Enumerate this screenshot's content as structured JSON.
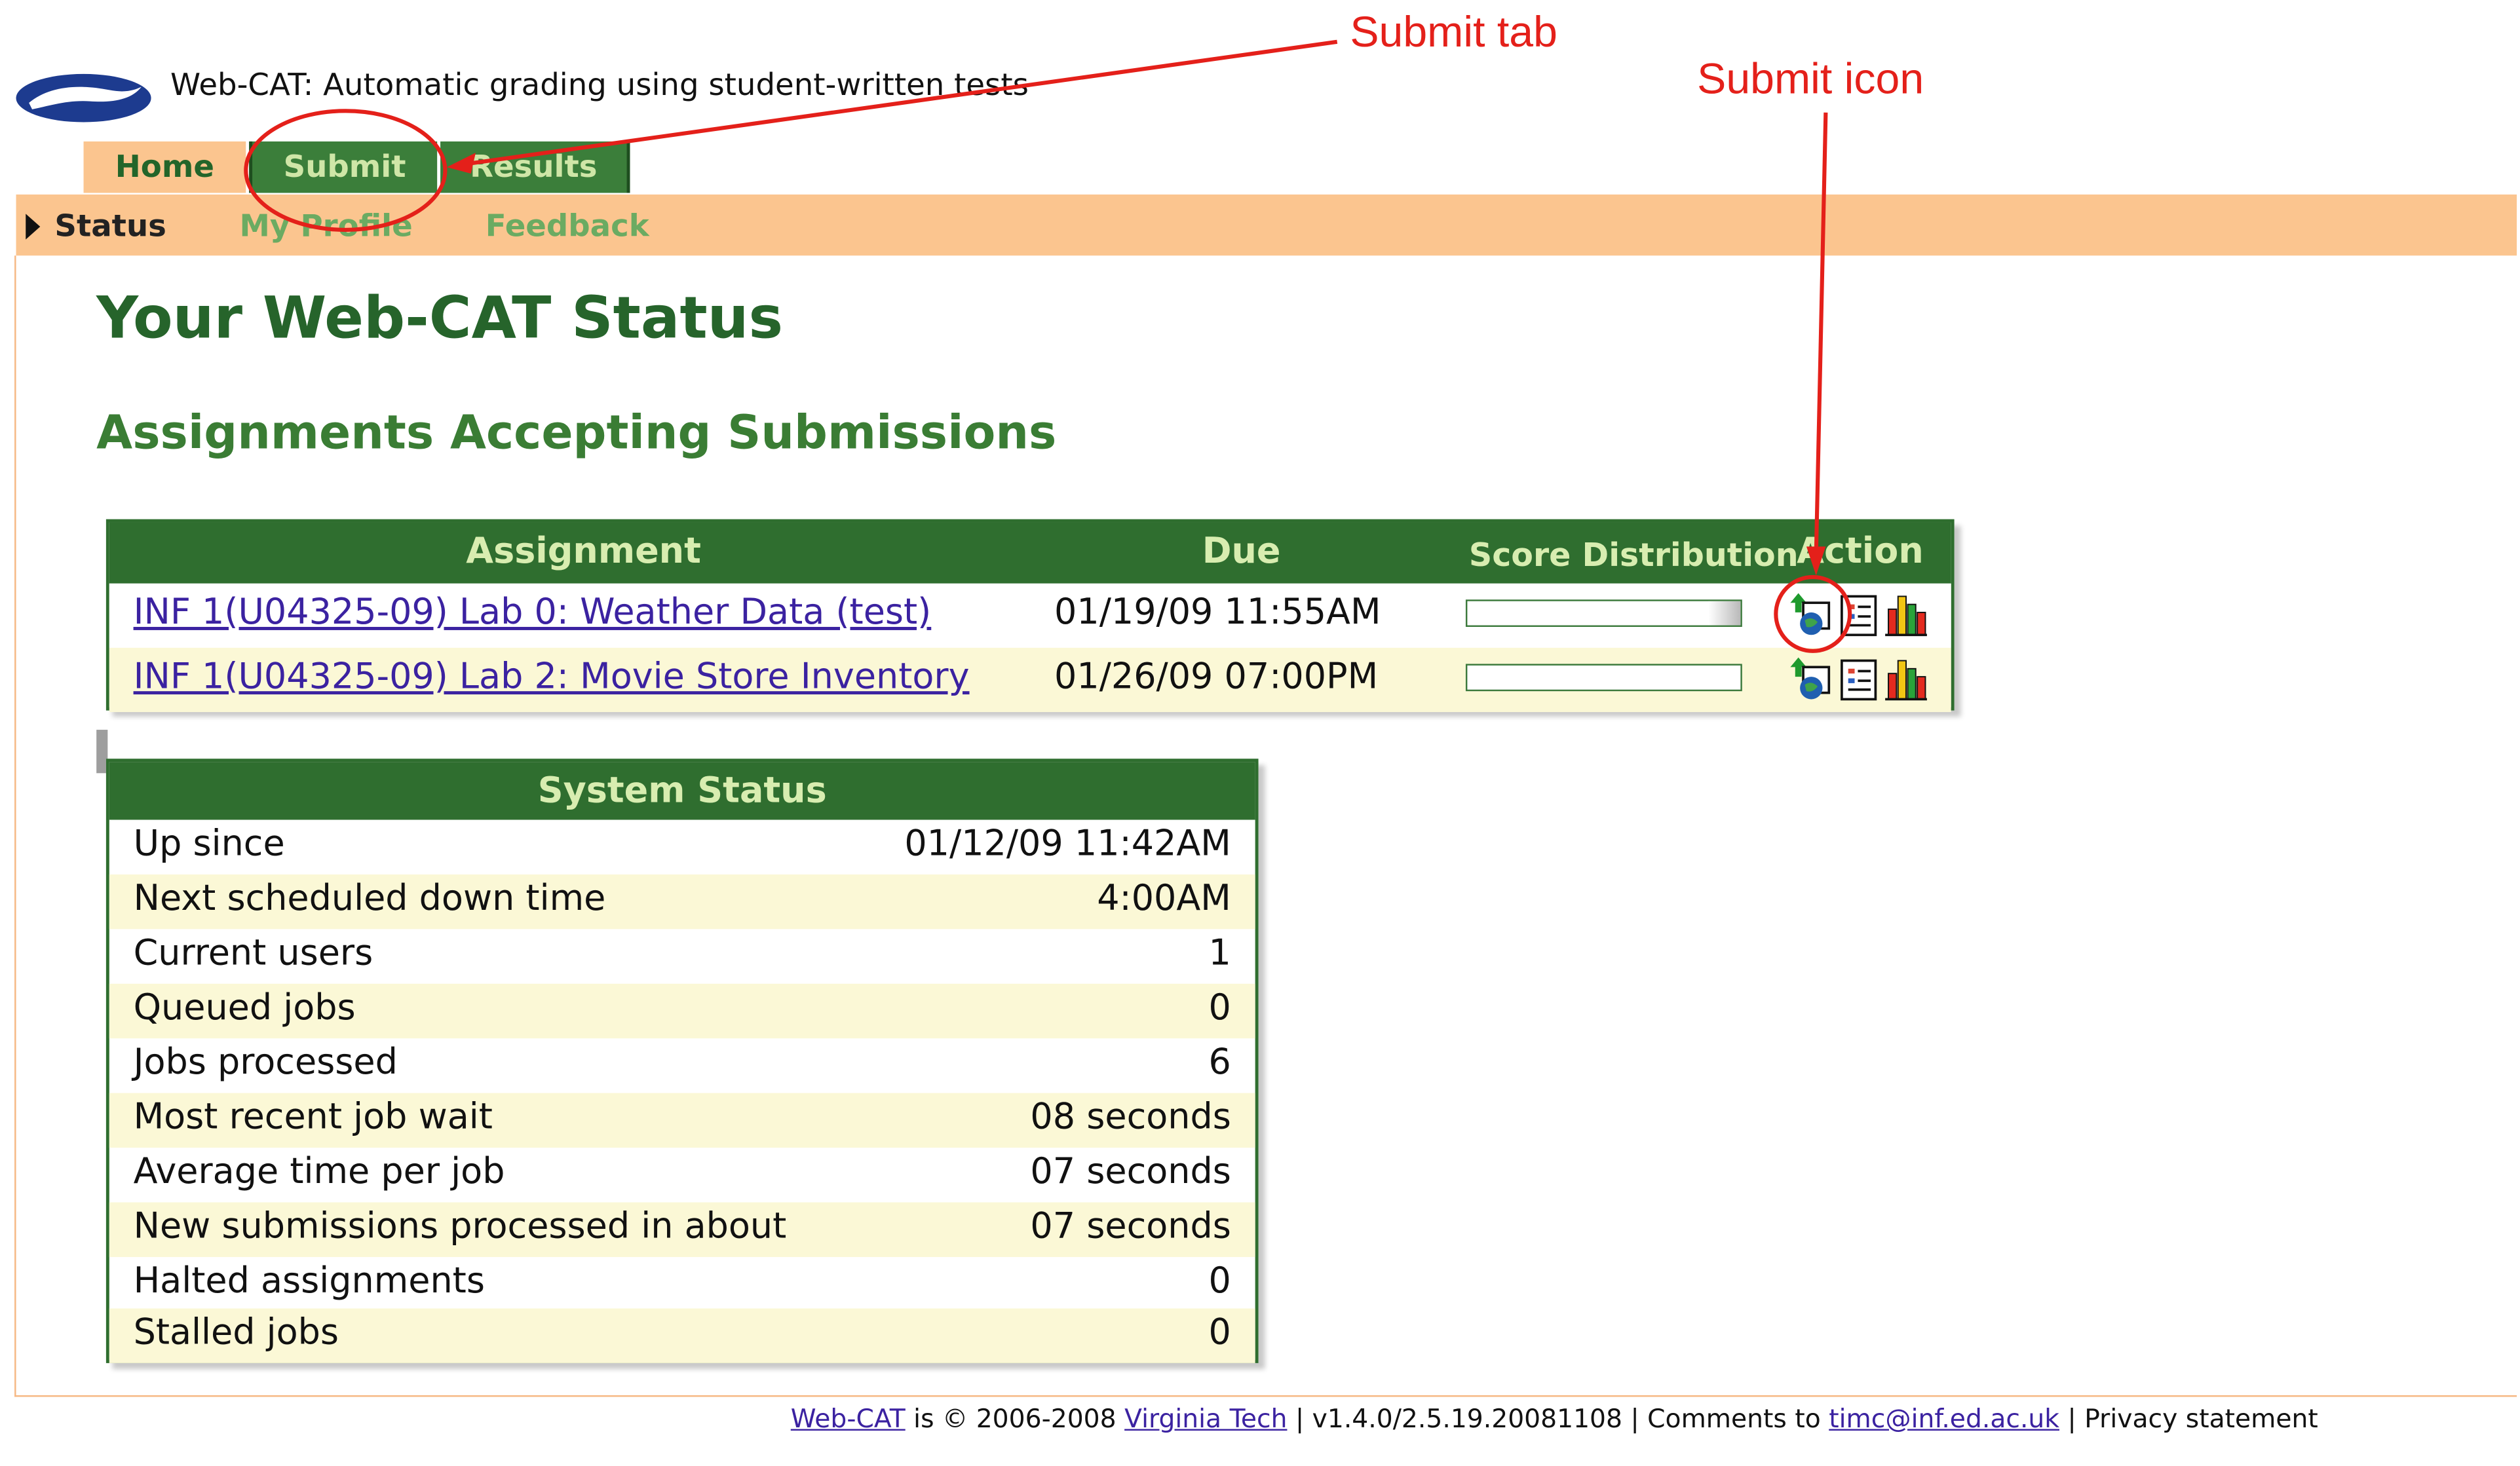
{
  "header": {
    "title": "Web-CAT: Automatic grading using student-written tests"
  },
  "tabs": [
    {
      "label": "Home"
    },
    {
      "label": "Submit"
    },
    {
      "label": "Results"
    }
  ],
  "subnav": [
    {
      "label": "Status"
    },
    {
      "label": "My Profile"
    },
    {
      "label": "Feedback"
    }
  ],
  "page_title": "Your Web-CAT Status",
  "assignments": {
    "section_title": "Assignments Accepting Submissions",
    "columns": [
      "Assignment",
      "Due",
      "Score Distribution",
      "Action"
    ],
    "rows": [
      {
        "name": "INF 1(U04325-09) Lab 0: Weather Data (test)",
        "due": "01/19/09 11:55AM",
        "score_fill": 0.12
      },
      {
        "name": "INF 1(U04325-09) Lab 2: Movie Store Inventory",
        "due": "01/26/09 07:00PM",
        "score_fill": 0
      }
    ],
    "action_icons": [
      "submit-icon",
      "report-icon",
      "chart-icon"
    ]
  },
  "system_status": {
    "title": "System Status",
    "rows": [
      {
        "label": "Up since",
        "value": "01/12/09 11:42AM"
      },
      {
        "label": "Next scheduled down time",
        "value": "4:00AM"
      },
      {
        "label": "Current users",
        "value": "1"
      },
      {
        "label": "Queued jobs",
        "value": "0"
      },
      {
        "label": "Jobs processed",
        "value": "6"
      },
      {
        "label": "Most recent job wait",
        "value": "08 seconds"
      },
      {
        "label": "Average time per job",
        "value": "07 seconds"
      },
      {
        "label": "New submissions processed in about",
        "value": "07 seconds"
      },
      {
        "label": "Halted assignments",
        "value": "0"
      },
      {
        "label": "Stalled jobs",
        "value": "0"
      }
    ]
  },
  "footer": {
    "webcat": "Web-CAT",
    "copyright": " is © 2006-2008 ",
    "vt": "Virginia Tech",
    "version": " | v1.4.0/2.5.19.20081108 | Comments to ",
    "email": "timc@inf.ed.ac.uk",
    "privacy": " | Privacy statement"
  },
  "annotations": {
    "submit_tab": "Submit tab",
    "submit_icon": "Submit icon"
  },
  "colors": {
    "tab_green": "#3b7e3a",
    "orange": "#fbc58f",
    "annotation_red": "#e4201a"
  }
}
